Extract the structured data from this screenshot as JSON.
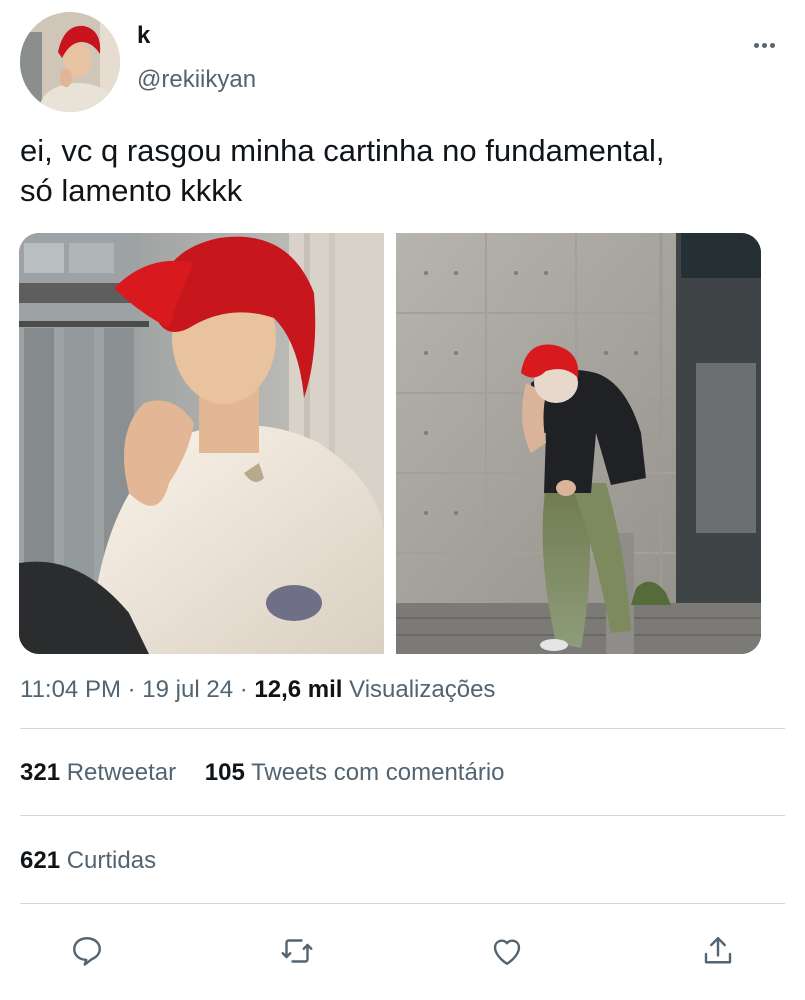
{
  "author": {
    "display_name": "k",
    "handle": "@rekiikyan"
  },
  "tweet": {
    "text": "ei, vc q rasgou minha cartinha no fundamental,\nsó lamento kkkk"
  },
  "meta": {
    "time": "11:04 PM",
    "date": "19 jul 24",
    "views_count": "12,6 mil",
    "views_label": "Visualizações"
  },
  "stats": {
    "retweets": {
      "count": "321",
      "label": "Retweetar"
    },
    "quotes": {
      "count": "105",
      "label": "Tweets com comentário"
    },
    "likes": {
      "count": "621",
      "label": "Curtidas"
    }
  },
  "icons": {
    "more": "more-horizontal-icon",
    "reply": "reply-icon",
    "retweet": "retweet-icon",
    "like": "heart-icon",
    "share": "share-icon"
  },
  "colors": {
    "text_primary": "#0f1419",
    "text_secondary": "#536471",
    "divider": "#cfd9de",
    "icon": "#536471",
    "hair_red": "#d81a1f"
  }
}
